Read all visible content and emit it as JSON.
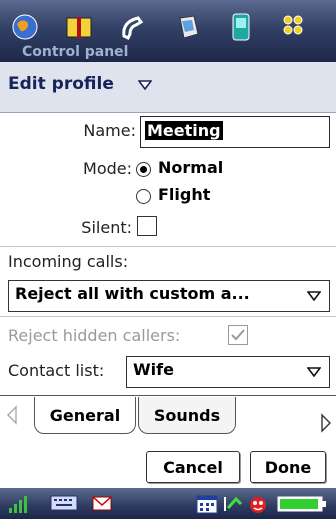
{
  "topbar": {
    "background_text": "Control panel",
    "apps": [
      "globe-icon",
      "book-icon",
      "phone-icon",
      "pda-icon",
      "mobile-icon",
      "apps-grid-icon"
    ]
  },
  "header": {
    "title": "Edit profile"
  },
  "form": {
    "name_label": "Name:",
    "name_value": "Meeting",
    "mode_label": "Mode:",
    "mode_options": [
      "Normal",
      "Flight"
    ],
    "mode_selected": "Normal",
    "silent_label": "Silent:",
    "silent_checked": false,
    "incoming_label": "Incoming calls:",
    "incoming_value": "Reject all with custom a...",
    "reject_hidden_label": "Reject hidden callers:",
    "reject_hidden_checked": true,
    "contact_list_label": "Contact list:",
    "contact_list_value": "Wife"
  },
  "tabs": [
    {
      "label": "General",
      "active": true
    },
    {
      "label": "Sounds",
      "active": false
    }
  ],
  "buttons": {
    "cancel": "Cancel",
    "done": "Done"
  },
  "colors": {
    "bar_dark": "#1d2848",
    "header_bg": "#dfe3ee",
    "header_text": "#16245a",
    "disabled_text": "#9a9a9a"
  }
}
